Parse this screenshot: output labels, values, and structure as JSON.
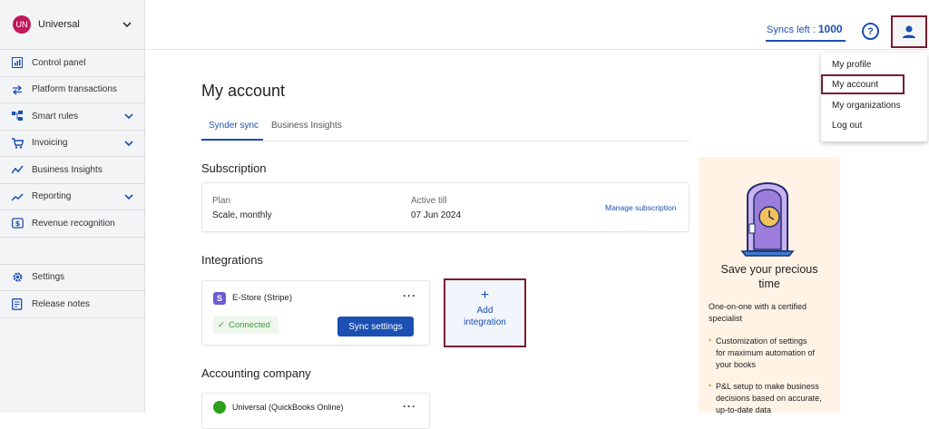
{
  "sidebar": {
    "org": {
      "initials": "UN",
      "name": "Universal"
    },
    "items": [
      {
        "label": "Control panel",
        "icon": "dashboard-icon",
        "expandable": false
      },
      {
        "label": "Platform transactions",
        "icon": "arrows-exchange-icon",
        "expandable": false
      },
      {
        "label": "Smart rules",
        "icon": "rules-icon",
        "expandable": true
      },
      {
        "label": "Invoicing",
        "icon": "cart-icon",
        "expandable": true
      },
      {
        "label": "Business Insights",
        "icon": "trend-icon",
        "expandable": false
      },
      {
        "label": "Reporting",
        "icon": "chart-line-icon",
        "expandable": true
      },
      {
        "label": "Revenue recognition",
        "icon": "dollar-icon",
        "expandable": false
      }
    ],
    "bottom_items": [
      {
        "label": "Settings",
        "icon": "gear-icon"
      },
      {
        "label": "Release notes",
        "icon": "notes-icon"
      }
    ]
  },
  "header": {
    "syncs_label": "Syncs left :",
    "syncs_value": "1000",
    "help_glyph": "?"
  },
  "user_menu": {
    "items": [
      "My profile",
      "My account",
      "My organizations",
      "Log out"
    ],
    "active": "My account"
  },
  "page": {
    "title": "My account",
    "tabs": [
      "Synder sync",
      "Business Insights"
    ],
    "active_tab": "Synder sync"
  },
  "subscription": {
    "heading": "Subscription",
    "plan_label": "Plan",
    "plan_value": "Scale, monthly",
    "active_label": "Active till",
    "active_value": "07 Jun 2024",
    "manage_link": "Manage subscription"
  },
  "integrations": {
    "heading": "Integrations",
    "items": [
      {
        "badge": "S",
        "name": "E-Store (Stripe)",
        "status": "Connected",
        "action": "Sync settings"
      }
    ],
    "add": {
      "plus": "+",
      "line1": "Add",
      "line2": "integration"
    }
  },
  "accounting": {
    "heading": "Accounting company",
    "items": [
      {
        "name": "Universal (QuickBooks Online)"
      }
    ]
  },
  "promo": {
    "title_line1": "Save your precious",
    "title_line2": "time",
    "intro_line1": "One-on-one with a certified",
    "intro_line2": "specialist",
    "bullets": [
      [
        "Customization of settings",
        "for maximum automation of",
        "your books"
      ],
      [
        "P&L setup to make business",
        "decisions based on accurate,",
        "up-to-date data"
      ]
    ]
  },
  "colors": {
    "primary": "#1b4fb3",
    "highlight": "#7a1c2e",
    "promo_bg": "#fff3e6",
    "success": "#3c9a3c"
  }
}
